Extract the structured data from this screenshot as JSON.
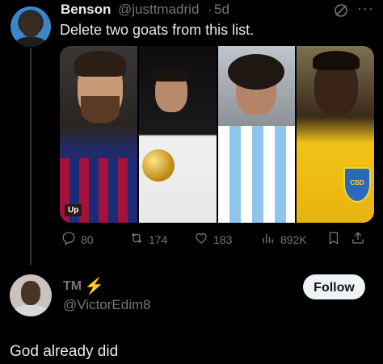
{
  "post": {
    "author_name": "Benson",
    "author_handle": "@justtmadrid",
    "dot": "·",
    "time": "5d",
    "text": "Delete two goats from this list.",
    "media_badge": "Up",
    "stats": {
      "replies": "80",
      "reposts": "174",
      "likes": "183",
      "views": "892K"
    },
    "cbd_label": "CBD"
  },
  "reply": {
    "author_name": "TM",
    "author_handle": "@VictorEdim8",
    "follow_label": "Follow",
    "text": "God already did"
  },
  "colors": {
    "background": "#000000",
    "text": "#e7e9ea",
    "muted": "#71767b",
    "follow_bg": "#eff3f4"
  },
  "icons": [
    "grok-icon",
    "more-icon",
    "reply-icon",
    "repost-icon",
    "like-icon",
    "views-icon",
    "bookmark-icon",
    "share-icon",
    "lightning-icon"
  ]
}
